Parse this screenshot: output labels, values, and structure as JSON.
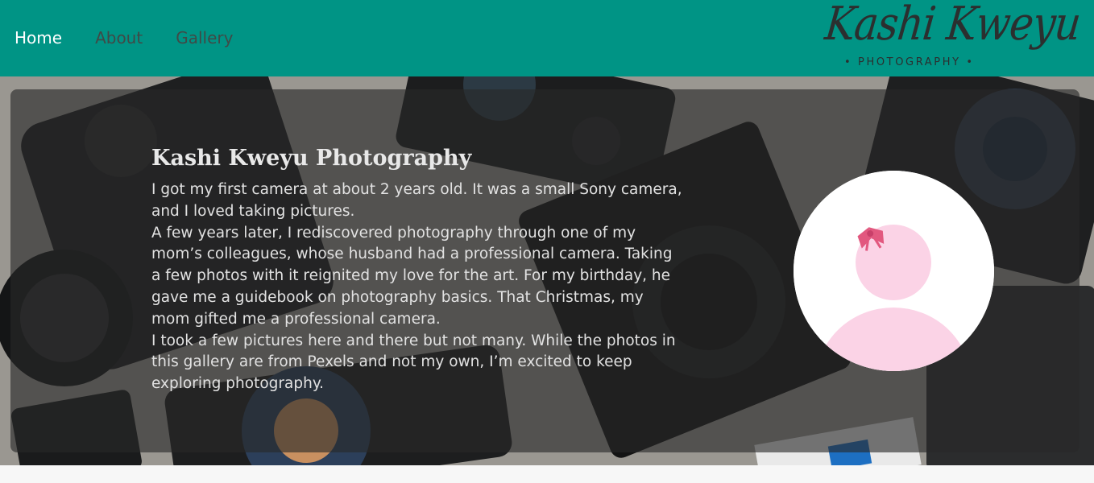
{
  "nav": {
    "items": [
      {
        "label": "Home"
      },
      {
        "label": "About"
      },
      {
        "label": "Gallery"
      }
    ]
  },
  "logo": {
    "script": "Kashi Kweyu",
    "sub": "• PHOTOGRAPHY •"
  },
  "about": {
    "title": "Kashi Kweyu Photography",
    "paragraphs": [
      "I got my first camera at about 2 years old. It was a small Sony camera, and I loved taking pictures.",
      "A few years later, I rediscovered photography through one of my mom’s colleagues, whose husband had a professional camera. Taking a few photos with it reignited my love for the art. For my birthday, he gave me a guidebook on photography basics. That Christmas, my mom gifted me a professional camera.",
      "I took a few pictures here and there but not many. While the photos in this gallery are from Pexels and not my own, I’m excited to keep exploring photography."
    ]
  },
  "colors": {
    "navbar": "#009485",
    "nav_active": "#ffffff",
    "nav_inactive": "#3f4a47",
    "avatar_pink": "#fbd3e6",
    "bow": "#e2587f"
  }
}
